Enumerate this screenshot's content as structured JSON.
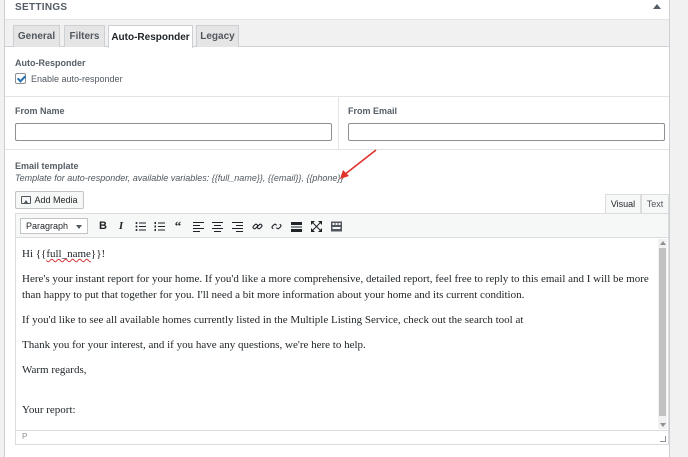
{
  "panel": {
    "title": "SETTINGS"
  },
  "tabs": [
    {
      "label": "General"
    },
    {
      "label": "Filters"
    },
    {
      "label": "Auto-Responder"
    },
    {
      "label": "Legacy"
    }
  ],
  "autoresponder": {
    "section_label": "Auto-Responder",
    "enable_label": "Enable auto-responder",
    "enabled": true
  },
  "from": {
    "name_label": "From Name",
    "name_value": "",
    "email_label": "From Email",
    "email_value": ""
  },
  "template": {
    "label": "Email template",
    "description": "Template for auto-responder, available variables: {{full_name}}, {{email}}, {{phone}}"
  },
  "editor": {
    "add_media_label": "Add Media",
    "visual_tab": "Visual",
    "text_tab": "Text",
    "format_select": "Paragraph",
    "greeting_prefix": "Hi {{",
    "greeting_var": "full_name",
    "greeting_suffix": "}}!",
    "paragraphs": [
      "Here's your instant report for your home. If you'd like a more comprehensive, detailed report, feel free to reply to this email and I will be more than happy to put that together for you. I'll need a bit more information about your home and its current condition.",
      "If you'd like to see all available homes currently listed in the Multiple Listing Service, check out the search tool at",
      "Thank you for your interest, and if you have any questions, we're here to help.",
      "Warm regards,"
    ],
    "closing": "Your report:",
    "status_path": "P"
  },
  "colors": {
    "annotation_arrow": "#e0312a",
    "checkbox_accent": "#2271b1"
  }
}
